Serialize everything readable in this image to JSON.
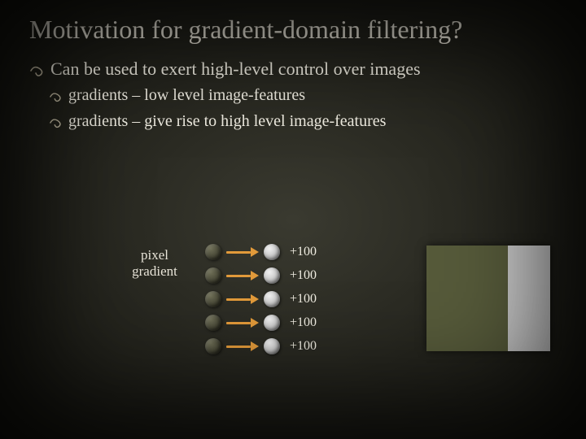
{
  "title": "Motivation for gradient-domain filtering?",
  "main_bullet": "Can be used to exert high-level control over images",
  "sub_bullets": [
    "gradients – low level image-features",
    "gradients – give rise to high level image-features"
  ],
  "diagram": {
    "label_line1": "pixel",
    "label_line2": "gradient",
    "rows": [
      {
        "value": "+100"
      },
      {
        "value": "+100"
      },
      {
        "value": "+100"
      },
      {
        "value": "+100"
      },
      {
        "value": "+100"
      }
    ]
  },
  "colors": {
    "accent_arrow": "#e29a3a",
    "box_dark": "#565a3a",
    "box_light": "#c9c9c9"
  }
}
